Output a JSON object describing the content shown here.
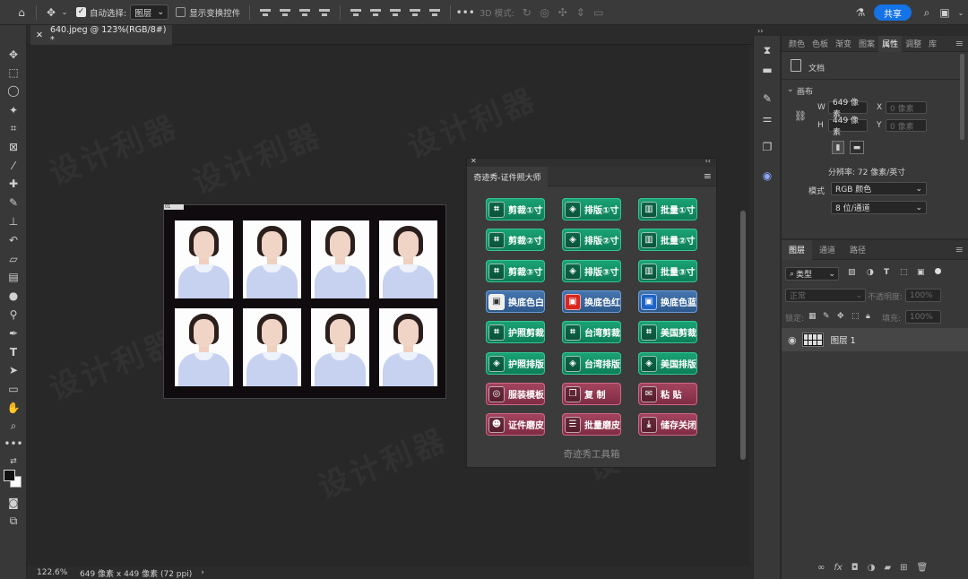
{
  "topbar": {
    "auto_select_label": "自动选择:",
    "auto_select_value": "图层",
    "show_transform_label": "显示变换控件",
    "mode_3d_label": "3D 模式:",
    "share_label": "共享"
  },
  "tab": {
    "title": "640.jpeg @ 123%(RGB/8#) *"
  },
  "status": {
    "zoom": "122.6%",
    "doc_info": "649 像素 x 449 像素 (72 ppi)"
  },
  "canvas": {
    "watermark": "设计利器"
  },
  "plugin": {
    "tab_title": "奇迹秀-证件照大师",
    "footer": "奇迹秀工具箱",
    "buttons": [
      {
        "label": "剪裁①寸",
        "color": "green",
        "icon": "crop-icon"
      },
      {
        "label": "排版①寸",
        "color": "green",
        "icon": "layers-icon"
      },
      {
        "label": "批量①寸",
        "color": "green",
        "icon": "bars-icon"
      },
      {
        "label": "剪裁②寸",
        "color": "green",
        "icon": "crop-icon"
      },
      {
        "label": "排版②寸",
        "color": "green",
        "icon": "layers-icon"
      },
      {
        "label": "批量②寸",
        "color": "green",
        "icon": "bars-icon"
      },
      {
        "label": "剪裁③寸",
        "color": "green",
        "icon": "crop-icon"
      },
      {
        "label": "排版③寸",
        "color": "green",
        "icon": "layers-icon"
      },
      {
        "label": "批量③寸",
        "color": "green",
        "icon": "bars-icon"
      },
      {
        "label": "换底色白",
        "color": "blue",
        "icon": "image-white-icon"
      },
      {
        "label": "换底色红",
        "color": "blue",
        "icon": "image-red-icon"
      },
      {
        "label": "换底色蓝",
        "color": "blue",
        "icon": "image-blue-icon"
      },
      {
        "label": "护照剪裁",
        "color": "green",
        "icon": "crop-icon"
      },
      {
        "label": "台湾剪裁",
        "color": "green",
        "icon": "crop-icon"
      },
      {
        "label": "美国剪裁",
        "color": "green",
        "icon": "crop-icon"
      },
      {
        "label": "护照排版",
        "color": "green",
        "icon": "layers-icon"
      },
      {
        "label": "台湾排版",
        "color": "green",
        "icon": "layers-icon"
      },
      {
        "label": "美国排版",
        "color": "green",
        "icon": "layers-icon"
      },
      {
        "label": "服装模板",
        "color": "red",
        "icon": "user-circle-icon"
      },
      {
        "label": "复 制",
        "color": "red",
        "icon": "copy-icon"
      },
      {
        "label": "粘 贴",
        "color": "red",
        "icon": "paste-icon"
      },
      {
        "label": "证件磨皮",
        "color": "red",
        "icon": "portrait-icon"
      },
      {
        "label": "批量磨皮",
        "color": "red",
        "icon": "list-icon"
      },
      {
        "label": "储存关闭",
        "color": "red",
        "icon": "save-icon"
      }
    ]
  },
  "properties": {
    "tabs": [
      "颜色",
      "色板",
      "渐变",
      "图案",
      "属性",
      "调整",
      "库"
    ],
    "active_tab": "属性",
    "doc_label": "文档",
    "section": "画布",
    "w_label": "W",
    "w_value": "649 像素",
    "h_label": "H",
    "h_value": "449 像素",
    "x_label": "X",
    "x_placeholder": "0 像素",
    "y_label": "Y",
    "y_placeholder": "0 像素",
    "resolution": "分辨率: 72 像素/英寸",
    "mode_label": "模式",
    "mode_value": "RGB 颜色",
    "depth_value": "8 位/通道"
  },
  "layers": {
    "tabs": [
      "图层",
      "通道",
      "路径"
    ],
    "filter_label": "类型",
    "blend_mode": "正常",
    "opacity_label": "不透明度:",
    "opacity_value": "100%",
    "lock_label": "锁定:",
    "fill_label": "填充:",
    "fill_value": "100%",
    "layer_name": "图层 1"
  }
}
